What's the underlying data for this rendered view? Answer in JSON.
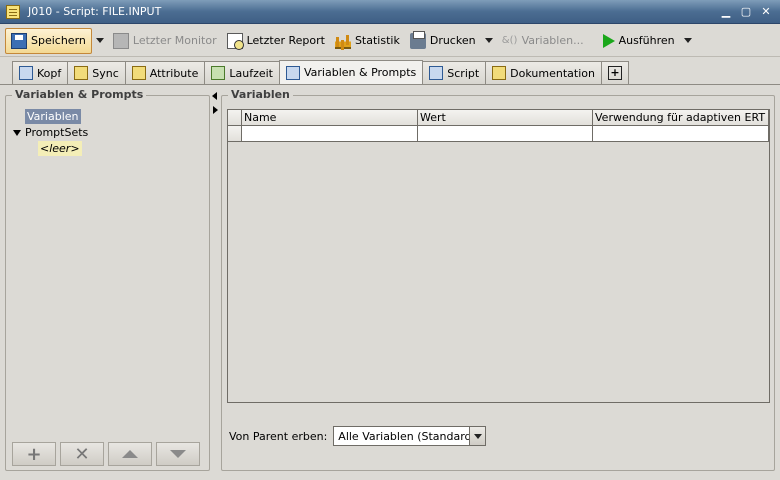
{
  "window": {
    "title": "J010 - Script: FILE.INPUT",
    "minimize": "▁",
    "maximize": "▢",
    "close": "✕"
  },
  "toolbar": {
    "save": "Speichern",
    "last_monitor": "Letzter Monitor",
    "last_report": "Letzter Report",
    "statistics": "Statistik",
    "print": "Drucken",
    "variables": "Variablen...",
    "execute": "Ausführen"
  },
  "tabs": [
    {
      "label": "Kopf"
    },
    {
      "label": "Sync"
    },
    {
      "label": "Attribute"
    },
    {
      "label": "Laufzeit"
    },
    {
      "label": "Variablen & Prompts"
    },
    {
      "label": "Script"
    },
    {
      "label": "Dokumentation"
    }
  ],
  "left_panel": {
    "title": "Variablen & Prompts",
    "tree": [
      {
        "label": "Variablen"
      },
      {
        "label": "PromptSets"
      },
      {
        "label": "<leer>"
      }
    ]
  },
  "right_panel": {
    "title": "Variablen",
    "columns": [
      "Name",
      "Wert",
      "Verwendung für adaptiven ERT als"
    ],
    "inherit_label": "Von Parent erben:",
    "inherit_value": "Alle Variablen (Standard)"
  }
}
